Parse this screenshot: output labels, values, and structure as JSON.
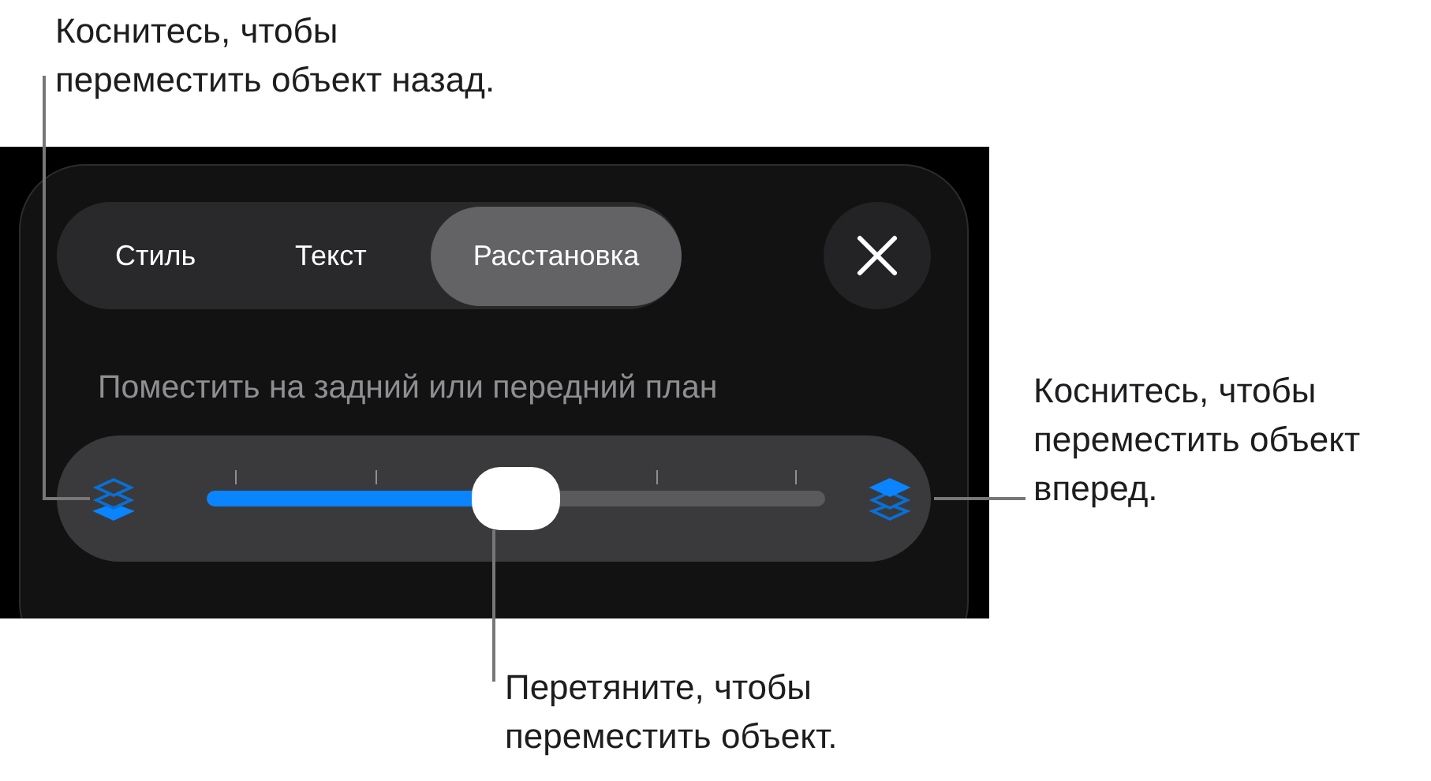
{
  "callouts": [
    {
      "text": "Коснитесь, чтобы переместить объект назад.",
      "kind": "back"
    },
    {
      "text": "Коснитесь, чтобы переместить объект вперед.",
      "kind": "forward"
    },
    {
      "text": "Перетяните, чтобы переместить объект.",
      "kind": "drag"
    }
  ],
  "tabs": [
    {
      "label": "Стиль",
      "selected": false
    },
    {
      "label": "Текст",
      "selected": false
    },
    {
      "label": "Расстановка",
      "selected": true
    }
  ],
  "section_title": "Поместить на задний или передний план",
  "slider": {
    "level": 0.5
  }
}
